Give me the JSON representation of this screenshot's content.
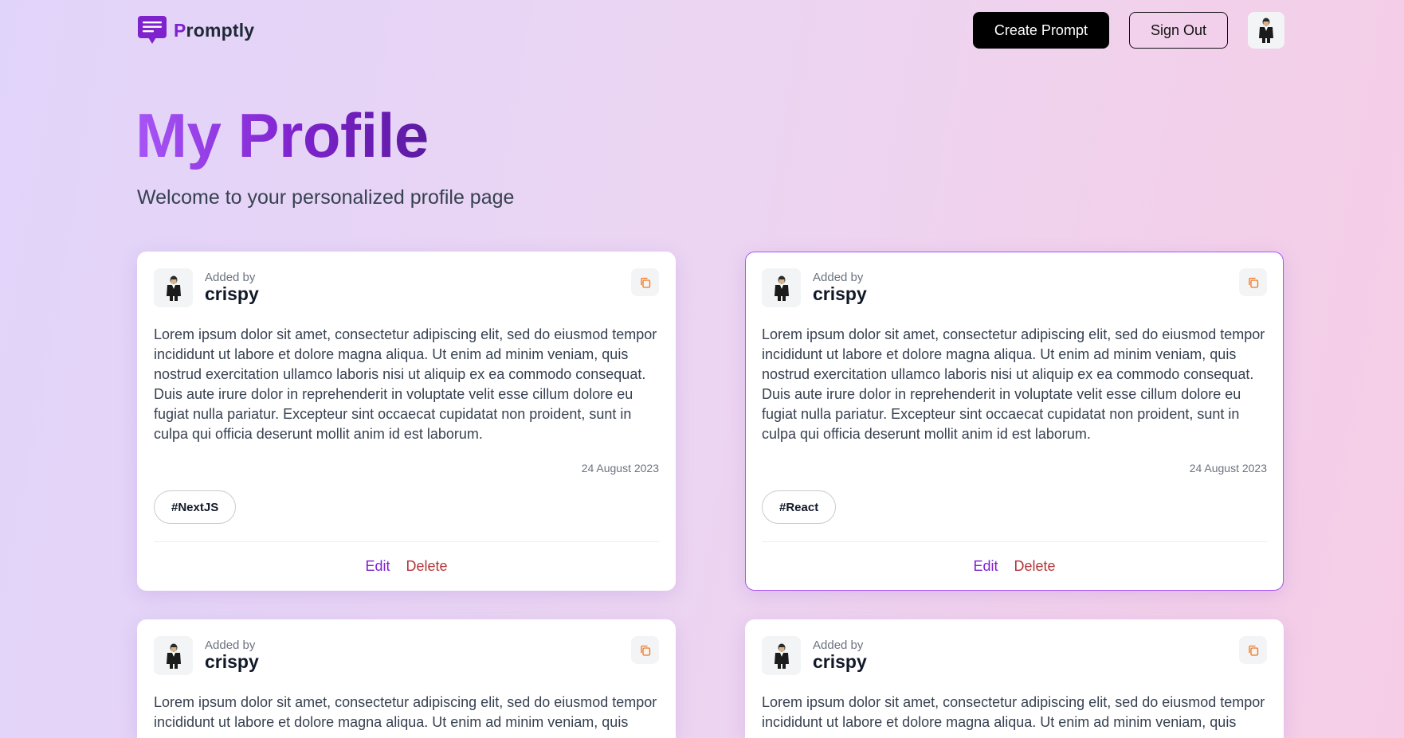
{
  "nav": {
    "brand": {
      "first_letter": "P",
      "rest": "romptly"
    },
    "create_label": "Create Prompt",
    "signout_label": "Sign Out",
    "logo_icon": "chat-bubble-icon",
    "avatar_icon": "user-avatar-icon"
  },
  "hero": {
    "title": "My Profile",
    "subtitle": "Welcome to your personalized profile page"
  },
  "colors": {
    "accent": "#7e22ce",
    "accent_light": "#a855f7",
    "delete": "#b3353a",
    "copy_icon": "#f97316"
  },
  "cards": [
    {
      "added_by": "Added by",
      "author": "crispy",
      "body": "Lorem ipsum dolor sit amet, consectetur adipiscing elit, sed do eiusmod tempor incididunt ut labore et dolore magna aliqua. Ut enim ad minim veniam, quis nostrud exercitation ullamco laboris nisi ut aliquip ex ea commodo consequat. Duis aute irure dolor in reprehenderit in voluptate velit esse cillum dolore eu fugiat nulla pariatur. Excepteur sint occaecat cupidatat non proident, sunt in culpa qui officia deserunt mollit anim id est laborum.",
      "date": "24 August 2023",
      "tag": "#NextJS",
      "edit_label": "Edit",
      "delete_label": "Delete"
    },
    {
      "added_by": "Added by",
      "author": "crispy",
      "body": "Lorem ipsum dolor sit amet, consectetur adipiscing elit, sed do eiusmod tempor incididunt ut labore et dolore magna aliqua. Ut enim ad minim veniam, quis nostrud exercitation ullamco laboris nisi ut aliquip ex ea commodo consequat. Duis aute irure dolor in reprehenderit in voluptate velit esse cillum dolore eu fugiat nulla pariatur. Excepteur sint occaecat cupidatat non proident, sunt in culpa qui officia deserunt mollit anim id est laborum.",
      "date": "24 August 2023",
      "tag": "#React",
      "edit_label": "Edit",
      "delete_label": "Delete"
    },
    {
      "added_by": "Added by",
      "author": "crispy",
      "body": "Lorem ipsum dolor sit amet, consectetur adipiscing elit, sed do eiusmod tempor incididunt ut labore et dolore magna aliqua. Ut enim ad minim veniam, quis"
    },
    {
      "added_by": "Added by",
      "author": "crispy",
      "body": "Lorem ipsum dolor sit amet, consectetur adipiscing elit, sed do eiusmod tempor incididunt ut labore et dolore magna aliqua. Ut enim ad minim veniam, quis"
    }
  ]
}
